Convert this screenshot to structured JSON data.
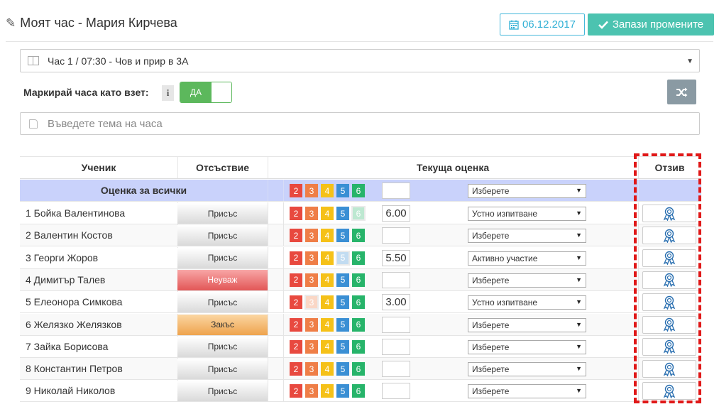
{
  "header": {
    "title": "Моят час - Мария Кирчева",
    "date": "06.12.2017",
    "save_label": "Запази промените"
  },
  "lesson": {
    "selected": "Час 1 / 07:30 - Чов и прир в 3А"
  },
  "mark_taken": {
    "label": "Маркирай часа като взет:",
    "info": "i",
    "toggle_label": "ДА"
  },
  "topic": {
    "placeholder": "Въведете тема на часа"
  },
  "table": {
    "headers": {
      "student": "Ученик",
      "absence": "Отсъствие",
      "grade": "Текуща оценка",
      "feedback": "Отзив"
    },
    "all_row_label": "Оценка за всички",
    "all_row_type": "Изберете",
    "grade_buttons": [
      {
        "label": "2",
        "color": "#e8493f"
      },
      {
        "label": "3",
        "color": "#ef7e47"
      },
      {
        "label": "4",
        "color": "#f5c118"
      },
      {
        "label": "5",
        "color": "#3a8fd4"
      },
      {
        "label": "6",
        "color": "#27b46a"
      }
    ],
    "rows": [
      {
        "name": "1 Бойка Валентинова",
        "absence": "Присъс",
        "absence_style": "present",
        "grade": "6.00",
        "selected_grade": "6",
        "type": "Устно изпитване"
      },
      {
        "name": "2 Валентин Костов",
        "absence": "Присъс",
        "absence_style": "present",
        "grade": "",
        "selected_grade": "",
        "type": "Изберете"
      },
      {
        "name": "3 Георги Жоров",
        "absence": "Присъс",
        "absence_style": "present",
        "grade": "5.50",
        "selected_grade": "5",
        "type": "Активно участие"
      },
      {
        "name": "4 Димитър Талев",
        "absence": "Неуваж",
        "absence_style": "unexcused",
        "grade": "",
        "selected_grade": "",
        "type": "Изберете"
      },
      {
        "name": "5 Елеонора Симкова",
        "absence": "Присъс",
        "absence_style": "present",
        "grade": "3.00",
        "selected_grade": "3",
        "type": "Устно изпитване"
      },
      {
        "name": "6 Желязко Желязков",
        "absence": "Закъс",
        "absence_style": "late",
        "grade": "",
        "selected_grade": "",
        "type": "Изберете"
      },
      {
        "name": "7 Зайка Борисова",
        "absence": "Присъс",
        "absence_style": "present",
        "grade": "",
        "selected_grade": "",
        "type": "Изберете"
      },
      {
        "name": "8 Константин Петров",
        "absence": "Присъс",
        "absence_style": "present",
        "grade": "",
        "selected_grade": "",
        "type": "Изберете"
      },
      {
        "name": "9 Николай Николов",
        "absence": "Присъс",
        "absence_style": "present",
        "grade": "",
        "selected_grade": "",
        "type": "Изберете"
      }
    ]
  },
  "icons": {
    "edit": "edit-icon",
    "calendar": "calendar-icon",
    "check": "check-icon",
    "book": "book-icon",
    "shuffle": "shuffle-icon",
    "note": "note-icon",
    "award": "award-icon"
  },
  "colors": {
    "accent_teal": "#4cc3b0",
    "info_blue": "#31b0d5",
    "toggle_green": "#5cb85c",
    "all_row_bg": "#c9d2fb",
    "highlight_red": "#e01818"
  }
}
